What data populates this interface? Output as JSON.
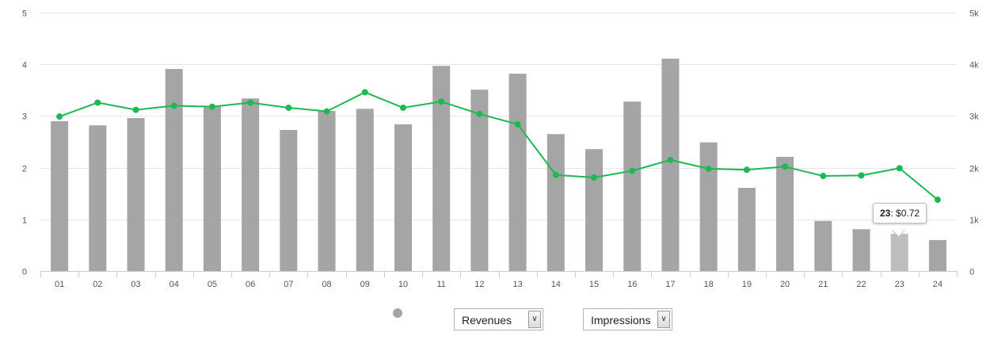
{
  "chart_data": {
    "type": "bar",
    "categories": [
      "01",
      "02",
      "03",
      "04",
      "05",
      "06",
      "07",
      "08",
      "09",
      "10",
      "11",
      "12",
      "13",
      "14",
      "15",
      "16",
      "17",
      "18",
      "19",
      "20",
      "21",
      "22",
      "23",
      "24"
    ],
    "series": [
      {
        "axis": "left",
        "kind": "bar",
        "color": "#a5a5a5",
        "values": [
          2.9,
          2.82,
          2.96,
          3.91,
          3.19,
          3.34,
          2.73,
          3.1,
          3.14,
          2.84,
          3.97,
          3.51,
          3.82,
          2.65,
          2.36,
          3.28,
          4.11,
          2.49,
          1.61,
          2.21,
          0.97,
          0.81,
          0.72,
          0.6
        ]
      },
      {
        "axis": "right",
        "kind": "line",
        "color": "#1db954",
        "values": [
          2990,
          3260,
          3120,
          3200,
          3180,
          3260,
          3160,
          3090,
          3460,
          3160,
          3280,
          3040,
          2840,
          1860,
          1810,
          1940,
          2150,
          1980,
          1960,
          2020,
          1840,
          1850,
          1990,
          1380
        ]
      }
    ],
    "y_left": {
      "ticks": [
        "0",
        "1",
        "2",
        "3",
        "4",
        "5"
      ],
      "ylim": [
        0,
        5
      ]
    },
    "y_right": {
      "ticks": [
        "0",
        "1k",
        "2k",
        "3k",
        "4k",
        "5k"
      ],
      "ylim": [
        0,
        5000
      ]
    },
    "highlight_index": 22,
    "highlight_color": "#bdbdbd",
    "grid": true,
    "legend_position": "bottom"
  },
  "tooltip": {
    "category": "23",
    "value": ": $0.72"
  },
  "controls": {
    "metric1": {
      "value": "Revenues"
    },
    "metric2": {
      "value": "Impressions"
    },
    "dropdown_icon": "chevron-down-icon",
    "dropdown_glyph": "∨"
  }
}
